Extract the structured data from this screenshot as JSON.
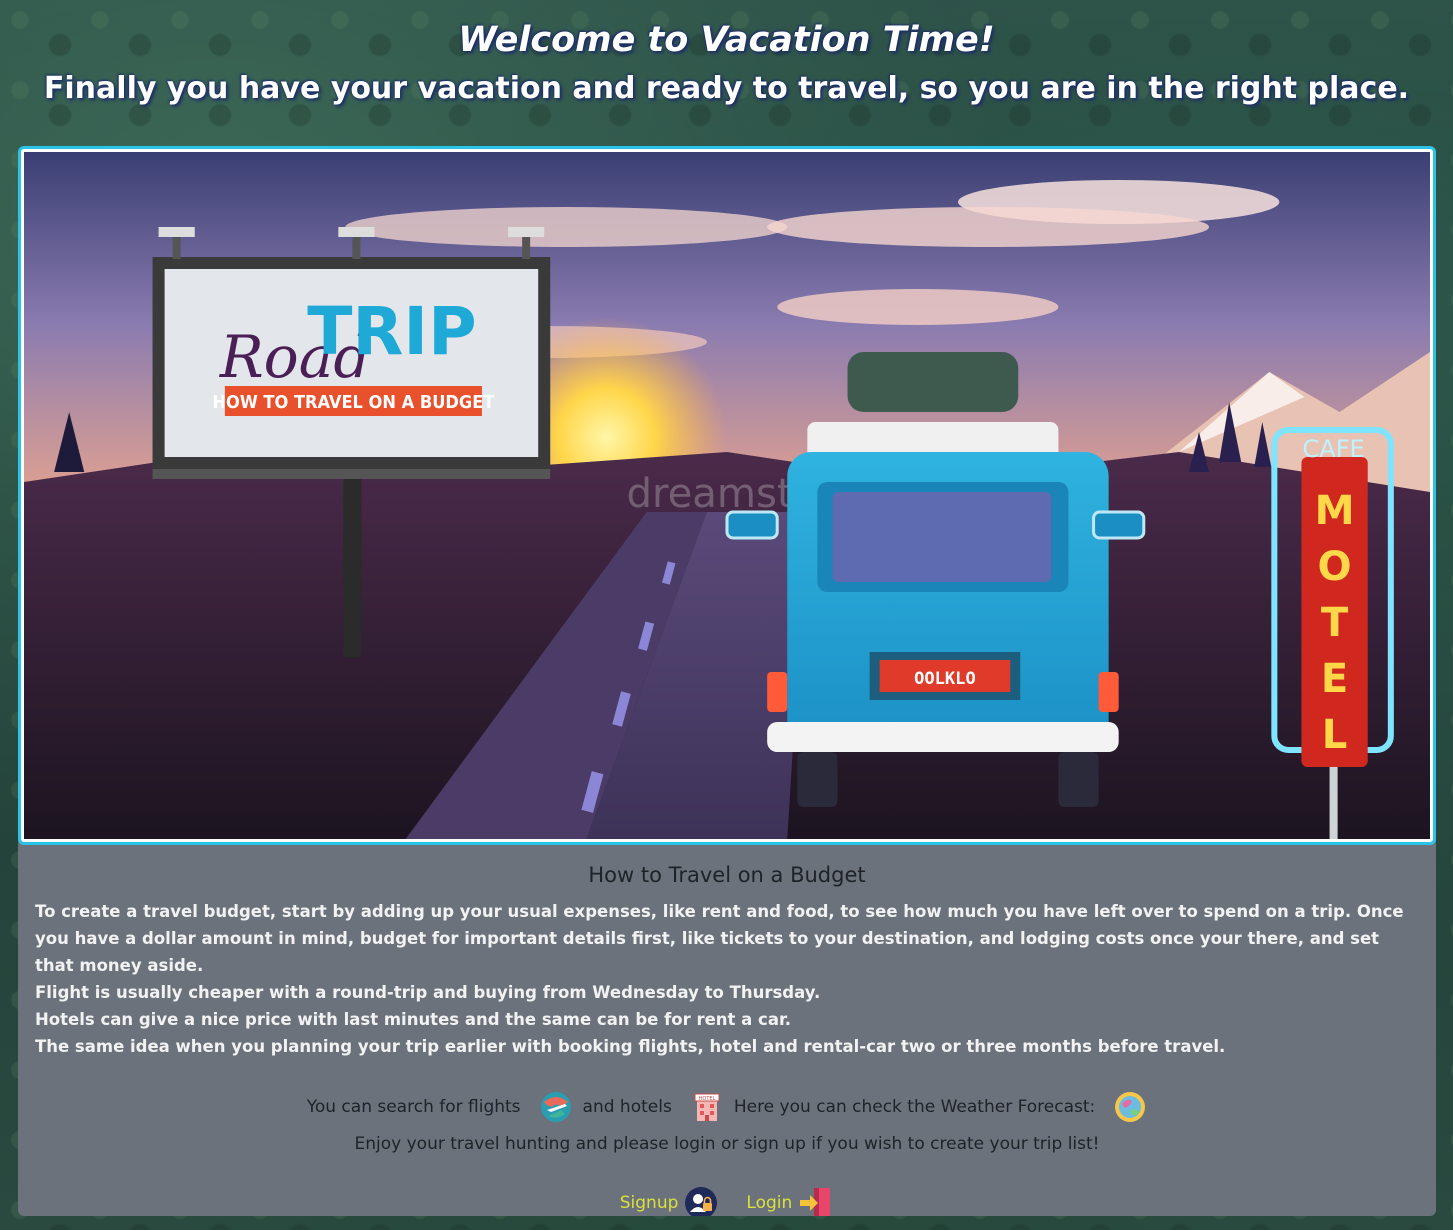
{
  "header": {
    "welcome": "Welcome to Vacation Time!",
    "tagline": "Finally you have your vacation and ready to travel, so you are in the right place."
  },
  "banner": {
    "billboard_word_road": "Road",
    "billboard_word_trip": "TRIP",
    "billboard_subtitle": "HOW TO TRAVEL ON A BUDGET",
    "license_plate": "OOLKLO",
    "sign_cafe": "CAFE",
    "sign_motel": [
      "M",
      "O",
      "T",
      "E",
      "L"
    ],
    "watermark": "dreamstime"
  },
  "info": {
    "title": "How to Travel on a Budget",
    "paragraphs": [
      "To create a travel budget, start by adding up your usual expenses, like rent and food, to see how much you have left over to spend on a trip. Once you have a dollar amount in mind, budget for important details first, like tickets to your destination, and lodging costs once your there, and set that money aside.",
      "Flight is usually cheaper with a round-trip and buying from Wednesday to Thursday.",
      "Hotels can give a nice price with last minutes and the same can be for rent a car.",
      "The same idea when you planning your trip earlier with booking flights, hotel and rental-car two or three months before travel."
    ],
    "search_flights_label": "You can search for flights",
    "hotels_label": "and hotels",
    "weather_label": "Here you can check the Weather Forecast:",
    "hotel_icon_text": "HOTEL",
    "enjoy": "Enjoy your travel hunting and please login or sign up if you wish to create your trip list!"
  },
  "auth": {
    "signup": "Signup",
    "login": "Login"
  },
  "colors": {
    "accent_border": "#2bc3e6",
    "card_bg": "#6b727c",
    "link": "#d8e23a"
  },
  "icons": [
    "flight-globe-icon",
    "hotel-icon",
    "weather-globe-icon",
    "signup-user-icon",
    "login-arrow-icon"
  ]
}
